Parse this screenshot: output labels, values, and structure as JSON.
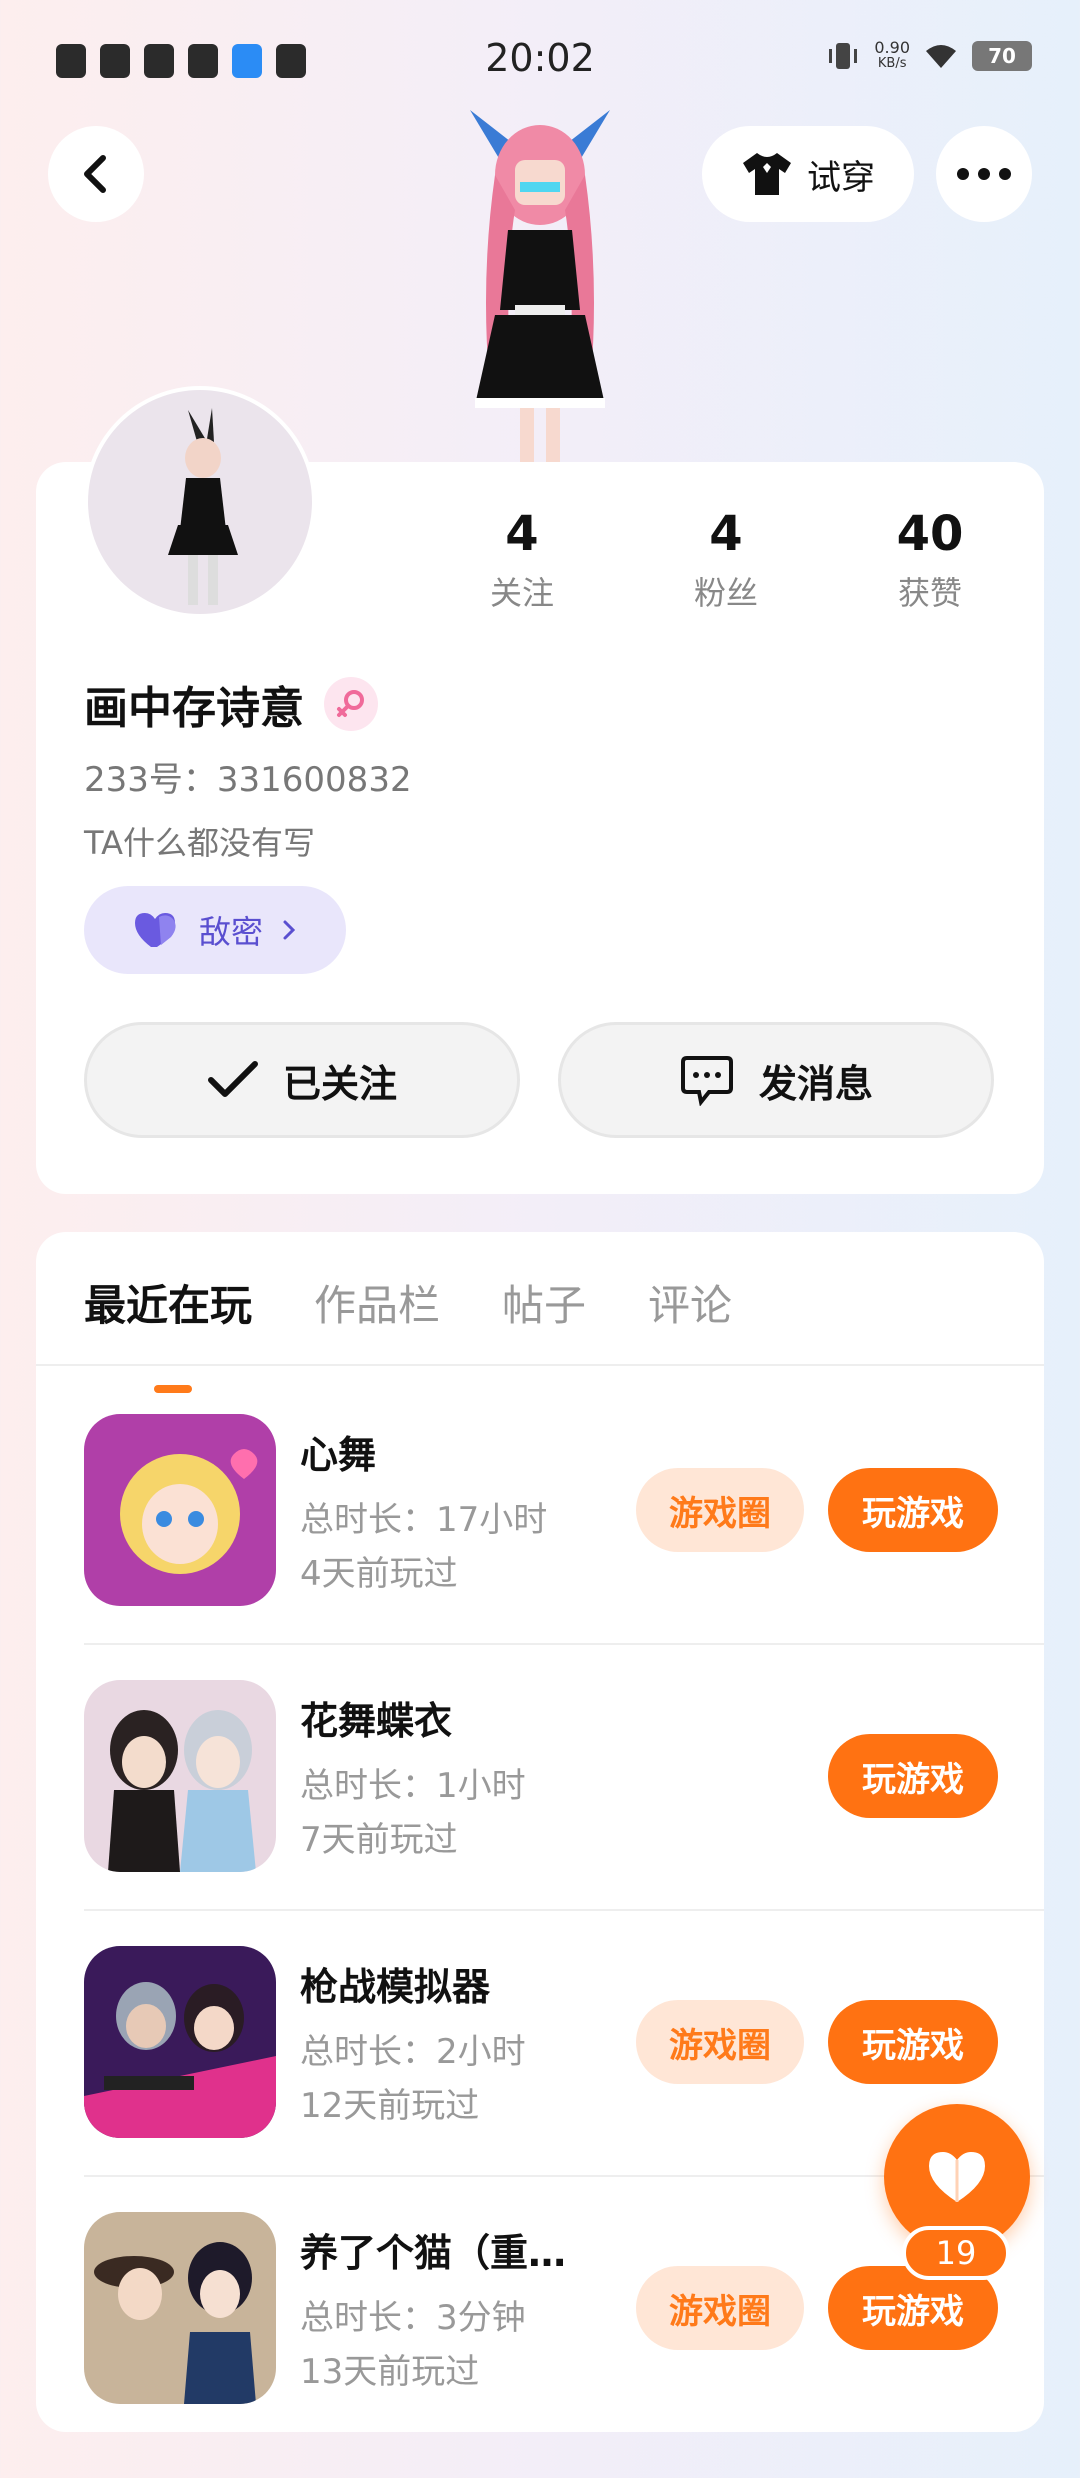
{
  "status_bar": {
    "time": "20:02",
    "net_speed": "0.90",
    "net_unit": "KB/s",
    "battery": "70"
  },
  "header": {
    "try_on_label": "试穿"
  },
  "profile": {
    "stats": [
      {
        "value": "4",
        "label": "关注"
      },
      {
        "value": "4",
        "label": "粉丝"
      },
      {
        "value": "40",
        "label": "获赞"
      }
    ],
    "name": "画中存诗意",
    "uid": "233号：331600832",
    "bio": "TA什么都没有写",
    "friend_label": "敌密",
    "follow_label": "已关注",
    "message_label": "发消息"
  },
  "tabs": [
    "最近在玩",
    "作品栏",
    "帖子",
    "评论"
  ],
  "games": [
    {
      "title": "心舞",
      "duration": "总时长：17小时",
      "last_played": "4天前玩过",
      "circle_label": "游戏圈",
      "play_label": "玩游戏"
    },
    {
      "title": "花舞蝶衣",
      "duration": "总时长：1小时",
      "last_played": "7天前玩过",
      "circle_label": "",
      "play_label": "玩游戏"
    },
    {
      "title": "枪战模拟器",
      "duration": "总时长：2小时",
      "last_played": "12天前玩过",
      "circle_label": "游戏圈",
      "play_label": "玩游戏"
    },
    {
      "title": "养了个猫（重…",
      "duration": "总时长：3分钟",
      "last_played": "13天前玩过",
      "circle_label": "游戏圈",
      "play_label": "玩游戏"
    }
  ],
  "fab": {
    "count": "19"
  },
  "colors": {
    "accent": "#ff7212",
    "accent_light": "#ffe6d6",
    "friend_bg": "#e9e6fb",
    "friend_text": "#5a4fd0"
  }
}
